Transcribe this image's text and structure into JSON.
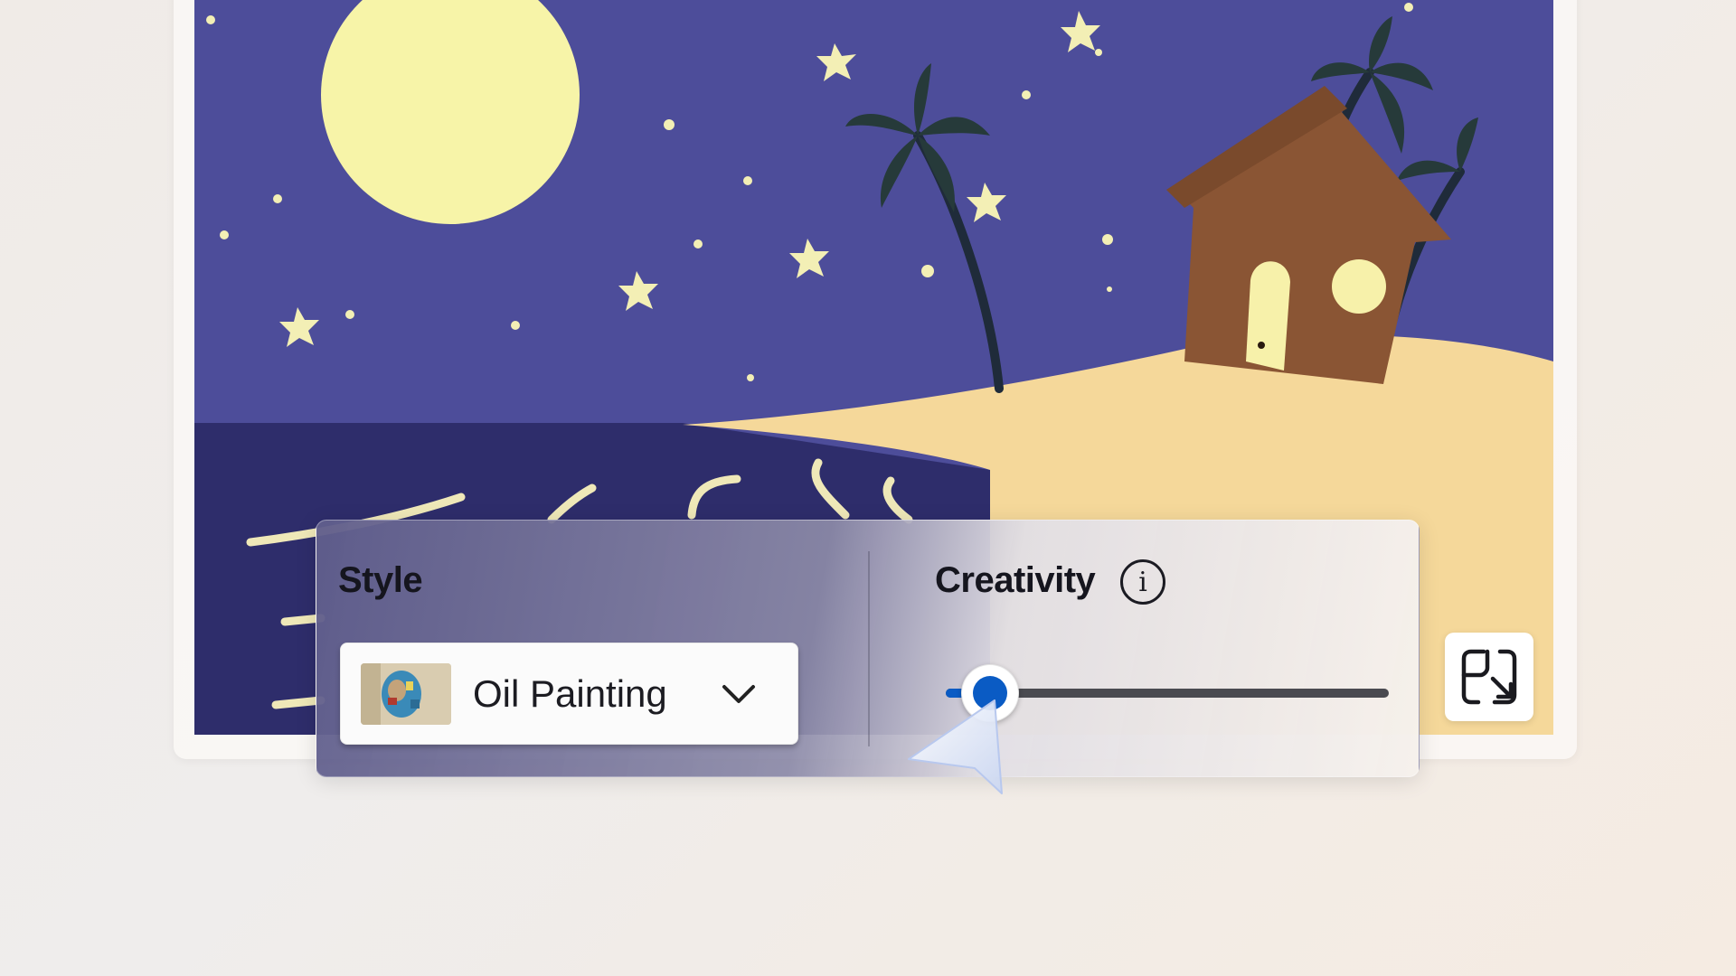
{
  "style_panel": {
    "style_label": "Style",
    "style_selected": "Oil Painting",
    "creativity_label": "Creativity",
    "info_glyph": "i",
    "creativity_slider": {
      "value": 0.1
    }
  },
  "icons": {
    "info": "info-icon",
    "dropdown": "chevron-down-icon",
    "resize": "resize-expand-icon",
    "cursor": "mouse-pointer-icon"
  },
  "colors": {
    "accent": "#0a5bc4",
    "sky": "#4d4d9a",
    "sea": "#2e2d6b",
    "sand": "#f5d89a",
    "moon": "#f7f4a8",
    "house": "#8a5534"
  }
}
